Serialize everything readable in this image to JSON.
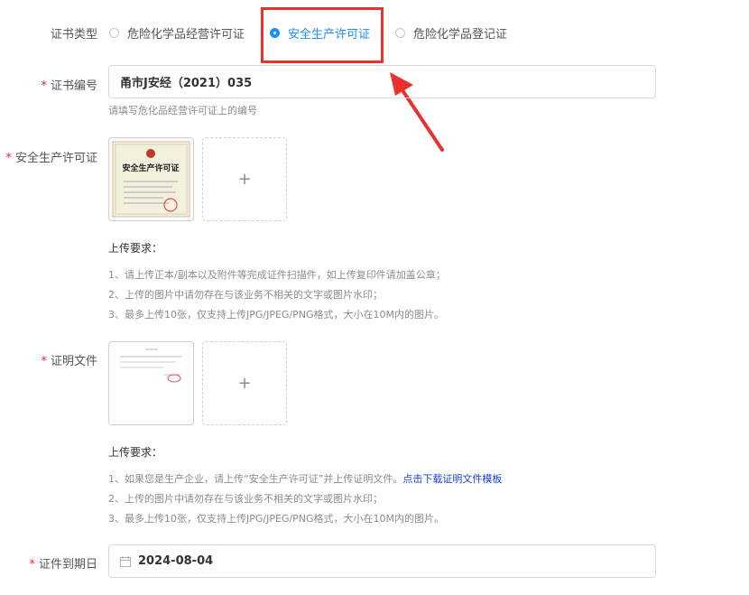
{
  "cert_type": {
    "label": "证书类型",
    "options": [
      {
        "label": "危险化学品经营许可证",
        "checked": false
      },
      {
        "label": "安全生产许可证",
        "checked": true
      },
      {
        "label": "危险化学品登记证",
        "checked": false
      }
    ]
  },
  "cert_number": {
    "required_mark": "*",
    "label": "证书编号",
    "value": "甬市J安经（2021）035",
    "hint": "请填写危化品经营许可证上的编号"
  },
  "license_upload": {
    "required_mark": "*",
    "label": "安全生产许可证",
    "thumbnail_title": "安全生产许可证",
    "add_symbol": "+",
    "requirements_title": "上传要求：",
    "requirements": [
      "1、请上传正本/副本以及附件等完成证件扫描件，如上传复印件请加盖公章；",
      "2、上传的图片中请勿存在与该业务不相关的文字或图片水印；",
      "3、最多上传10张，仅支持上传JPG/JPEG/PNG格式，大小在10M内的图片。"
    ]
  },
  "proof_upload": {
    "required_mark": "*",
    "label": "证明文件",
    "add_symbol": "+",
    "requirements_title": "上传要求：",
    "req1_text": "1、如果您是生产企业，请上传“安全生产许可证”并上传证明文件。",
    "req1_link": "点击下载证明文件模板",
    "requirements": [
      "2、上传的图片中请勿存在与该业务不相关的文字或图片水印；",
      "3、最多上传10张，仅支持上传JPG/JPEG/PNG格式，大小在10M内的图片。"
    ]
  },
  "expiry": {
    "required_mark": "*",
    "label": "证件到期日",
    "value": "2024-08-04",
    "icon": "calendar-icon"
  },
  "annotation": {
    "highlight_color": "#e8322b",
    "arrow_color": "#e8322b"
  }
}
